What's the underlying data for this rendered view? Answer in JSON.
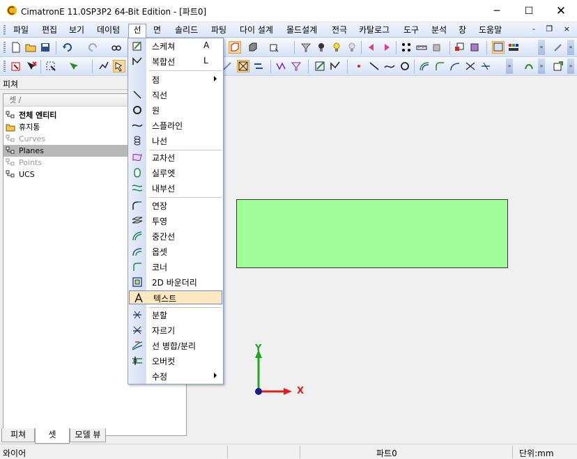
{
  "window": {
    "title": "CimatronE 11.0SP3P2 64-Bit Edition - [파트0]",
    "minimize": "─",
    "maximize": "☐",
    "close": "✕"
  },
  "menubar": {
    "items": [
      "파일",
      "편집",
      "보기",
      "데이텀",
      "선",
      "면",
      "솔리드",
      "파팅",
      "다이 설계",
      "몰드설계",
      "전극",
      "카탈로그",
      "도구",
      "분석",
      "창",
      "도움말"
    ],
    "active": "선",
    "mdi_controls": "- ❐ ×"
  },
  "left_panel": {
    "title": "피쳐",
    "tree_header": "셋 /",
    "rows": [
      {
        "label": "전체 엔티티",
        "icon": "hierarchy-icon",
        "style": "bold"
      },
      {
        "label": "휴지통",
        "icon": "folder-icon",
        "style": "normal"
      },
      {
        "label": "Curves",
        "icon": "hierarchy-icon",
        "style": "dim"
      },
      {
        "label": "Planes",
        "icon": "hierarchy-icon",
        "style": "selected"
      },
      {
        "label": "Points",
        "icon": "hierarchy-icon",
        "style": "dim"
      },
      {
        "label": "UCS",
        "icon": "hierarchy-icon",
        "style": "normal"
      }
    ],
    "tabs": [
      "피쳐",
      "셋",
      "모델 뷰"
    ],
    "active_tab": "셋"
  },
  "viewport": {
    "rect_fill": "#a0fd99",
    "axis_x_label": "X",
    "axis_y_label": "Y",
    "axis_x_color": "#e0201a",
    "axis_y_color": "#1ea81e"
  },
  "dropdown": {
    "items": [
      {
        "label": "스케쳐",
        "shortcut": "A",
        "icon": "sketcher-icon"
      },
      {
        "label": "복합선",
        "shortcut": "L",
        "icon": "composite-curve-icon"
      },
      {
        "separator": true
      },
      {
        "label": "점",
        "submenu": true,
        "icon": ""
      },
      {
        "label": "직선",
        "icon": "line-icon"
      },
      {
        "label": "원",
        "icon": "circle-icon"
      },
      {
        "label": "스플라인",
        "icon": "spline-icon"
      },
      {
        "label": "나선",
        "icon": "helix-icon"
      },
      {
        "separator": true
      },
      {
        "label": "교차선",
        "icon": "intersection-icon"
      },
      {
        "label": "실루엣",
        "icon": "silhouette-icon"
      },
      {
        "label": "내부선",
        "icon": "interior-curve-icon"
      },
      {
        "separator": true
      },
      {
        "label": "연장",
        "icon": "extend-icon"
      },
      {
        "label": "투영",
        "icon": "project-icon"
      },
      {
        "label": "중간선",
        "icon": "middle-curve-icon"
      },
      {
        "label": "옵셋",
        "icon": "offset-icon"
      },
      {
        "label": "코너",
        "icon": "corner-icon"
      },
      {
        "label": "2D 바운더리",
        "icon": "boundary-2d-icon"
      },
      {
        "label": "텍스트",
        "icon": "text-icon",
        "hover": true
      },
      {
        "separator": true
      },
      {
        "label": "분할",
        "icon": "split-icon"
      },
      {
        "label": "자르기",
        "icon": "trim-icon"
      },
      {
        "label": "선 병합/분리",
        "icon": "merge-split-icon"
      },
      {
        "label": "오버컷",
        "icon": "overcut-icon"
      },
      {
        "label": "수정",
        "submenu": true,
        "icon": ""
      }
    ]
  },
  "statusbar": {
    "left": "와이어",
    "part": "파트0",
    "units": "단위:mm"
  }
}
